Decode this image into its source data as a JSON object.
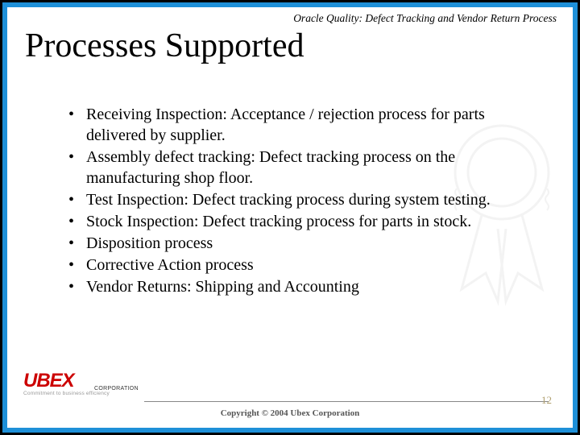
{
  "header": {
    "subtitle": "Oracle Quality: Defect Tracking and Vendor Return Process"
  },
  "title": "Processes Supported",
  "bullets": [
    "Receiving Inspection: Acceptance / rejection process for parts delivered by supplier.",
    "Assembly defect tracking: Defect tracking process on the manufacturing shop floor.",
    "Test Inspection: Defect tracking process during system testing.",
    "Stock Inspection: Defect tracking process for parts in stock.",
    "Disposition process",
    "Corrective Action process",
    "Vendor Returns: Shipping and Accounting"
  ],
  "footer": {
    "logo_main": "UBEX",
    "logo_corp": "CORPORATION",
    "logo_tagline": "Commitment to business efficiency",
    "copyright": "Copyright © 2004 Ubex Corporation",
    "page_number": "12"
  }
}
